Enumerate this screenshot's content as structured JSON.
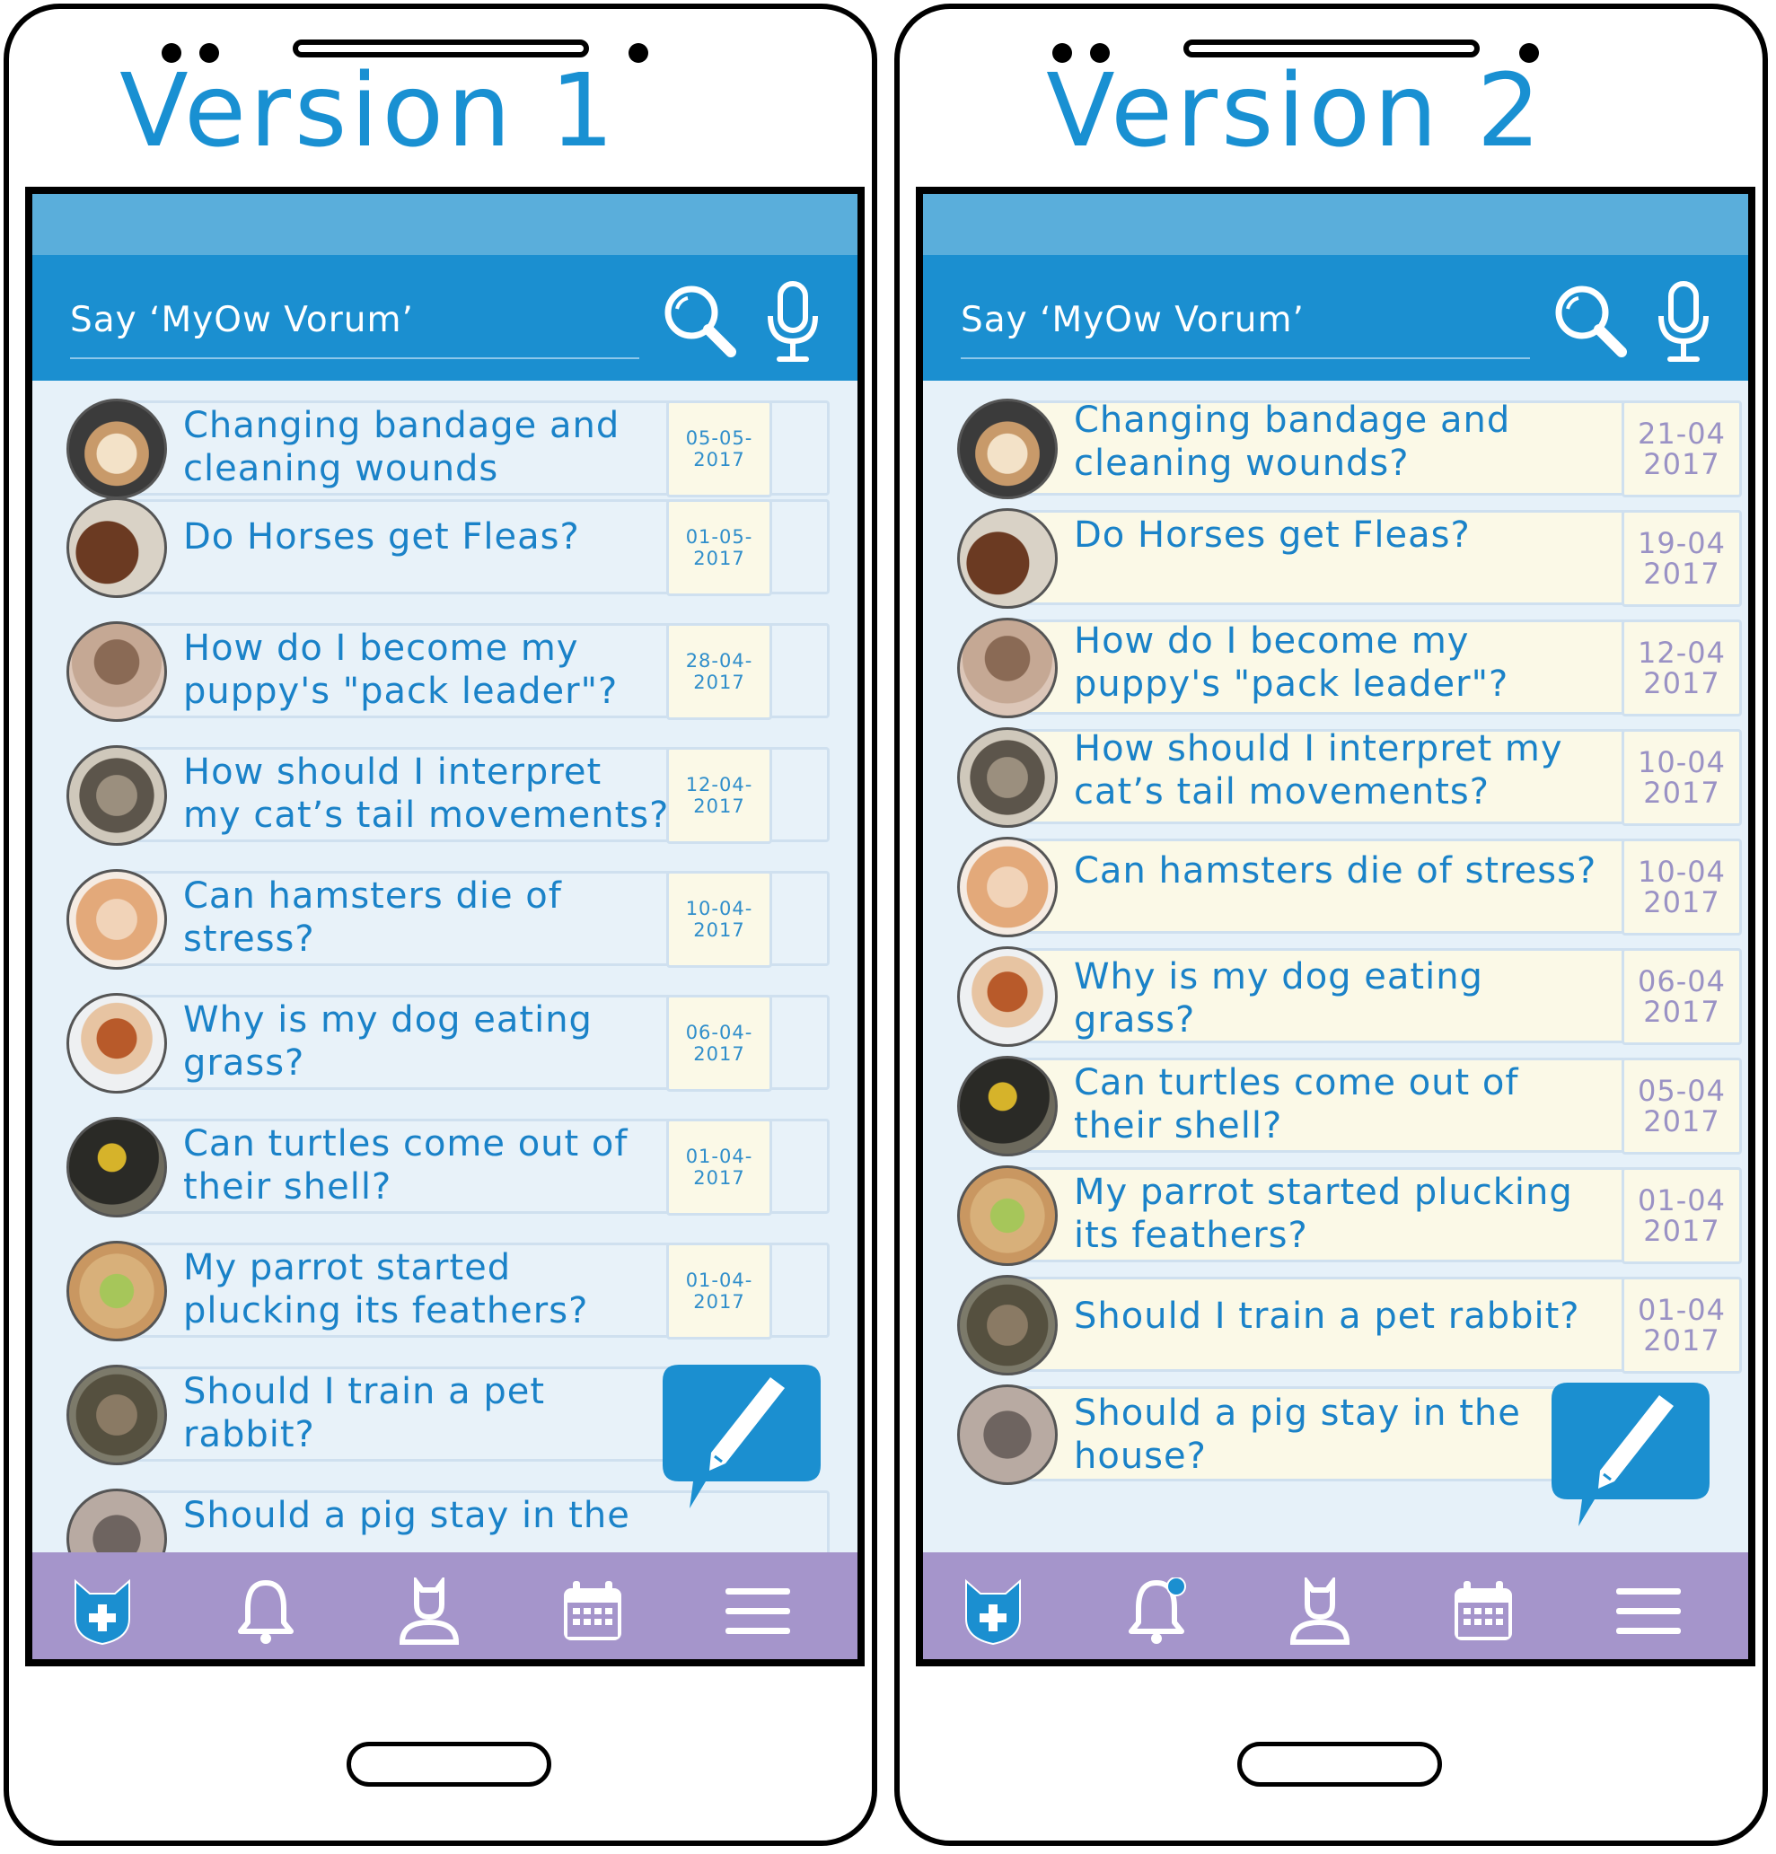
{
  "phones": [
    {
      "title": "Version 1",
      "search": {
        "placeholder": "Say ‘MyOw Vorum’"
      },
      "posts": [
        {
          "title_line1": "Changing bandage and",
          "title_line2": "cleaning wounds",
          "date": "05-05-2017",
          "avatar": "yorkie-dog"
        },
        {
          "title_line1": "Do Horses get Fleas?",
          "title_line2": "",
          "date": "01-05-2017",
          "avatar": "horse"
        },
        {
          "title_line1": "How do I become my",
          "title_line2": "puppy's \"pack leader\"?",
          "date": "28-04-2017",
          "avatar": "pug-puppy"
        },
        {
          "title_line1": "How should I interpret",
          "title_line2": "my cat’s tail movements?",
          "date": "12-04-2017",
          "avatar": "cat"
        },
        {
          "title_line1": "Can hamsters die of",
          "title_line2": "stress?",
          "date": "10-04-2017",
          "avatar": "hamster"
        },
        {
          "title_line1": "Why is my dog eating",
          "title_line2": "grass?",
          "date": "06-04-2017",
          "avatar": "small-dog"
        },
        {
          "title_line1": "Can turtles come out of",
          "title_line2": "their shell?",
          "date": "01-04-2017",
          "avatar": "turtle"
        },
        {
          "title_line1": "My parrot started",
          "title_line2": "plucking its feathers?",
          "date": "01-04-2017",
          "avatar": "parrot"
        },
        {
          "title_line1": "Should I train a pet",
          "title_line2": "rabbit?",
          "date": "",
          "avatar": "rabbit"
        },
        {
          "title_line1": "Should a pig stay in the",
          "title_line2": "",
          "date": "",
          "avatar": "pig"
        }
      ],
      "notification_dot": false
    },
    {
      "title": "Version 2",
      "search": {
        "placeholder": "Say ‘MyOw Vorum’"
      },
      "posts": [
        {
          "title_line1": "Changing bandage and",
          "title_line2": "cleaning wounds?",
          "date_line1": "21-04",
          "date_line2": "2017",
          "avatar": "yorkie-dog"
        },
        {
          "title_line1": "Do Horses get Fleas?",
          "title_line2": "",
          "date_line1": "19-04",
          "date_line2": "2017",
          "avatar": "horse"
        },
        {
          "title_line1": "How do I become my",
          "title_line2": "puppy's \"pack leader\"?",
          "date_line1": "12-04",
          "date_line2": "2017",
          "avatar": "pug-puppy"
        },
        {
          "title_line1": "How should I interpret my",
          "title_line2": "cat’s tail movements?",
          "date_line1": "10-04",
          "date_line2": "2017",
          "avatar": "cat"
        },
        {
          "title_line1": "Can hamsters die of stress?",
          "title_line2": "",
          "date_line1": "10-04",
          "date_line2": "2017",
          "avatar": "hamster"
        },
        {
          "title_line1": "Why is my dog eating",
          "title_line2": "grass?",
          "date_line1": "06-04",
          "date_line2": "2017",
          "avatar": "small-dog"
        },
        {
          "title_line1": "Can turtles come out of",
          "title_line2": "their shell?",
          "date_line1": "05-04",
          "date_line2": "2017",
          "avatar": "turtle"
        },
        {
          "title_line1": "My parrot started plucking",
          "title_line2": "its feathers?",
          "date_line1": "01-04",
          "date_line2": "2017",
          "avatar": "parrot"
        },
        {
          "title_line1": "Should I train a pet rabbit?",
          "title_line2": "",
          "date_line1": "01-04",
          "date_line2": "2017",
          "avatar": "rabbit"
        },
        {
          "title_line1": "Should a pig stay in the",
          "title_line2": "house?",
          "date_line1": "",
          "date_line2": "",
          "avatar": "pig"
        }
      ],
      "notification_dot": true
    }
  ],
  "nav_icons": [
    "medical-cat-icon",
    "bell-icon",
    "profile-icon",
    "calendar-icon",
    "menu-icon"
  ],
  "colors": {
    "accent": "#1b8fd0",
    "statusbar": "#5aaedb",
    "nav": "#a595cb",
    "title": "#1990d2",
    "date_v2": "#9a92c5"
  }
}
